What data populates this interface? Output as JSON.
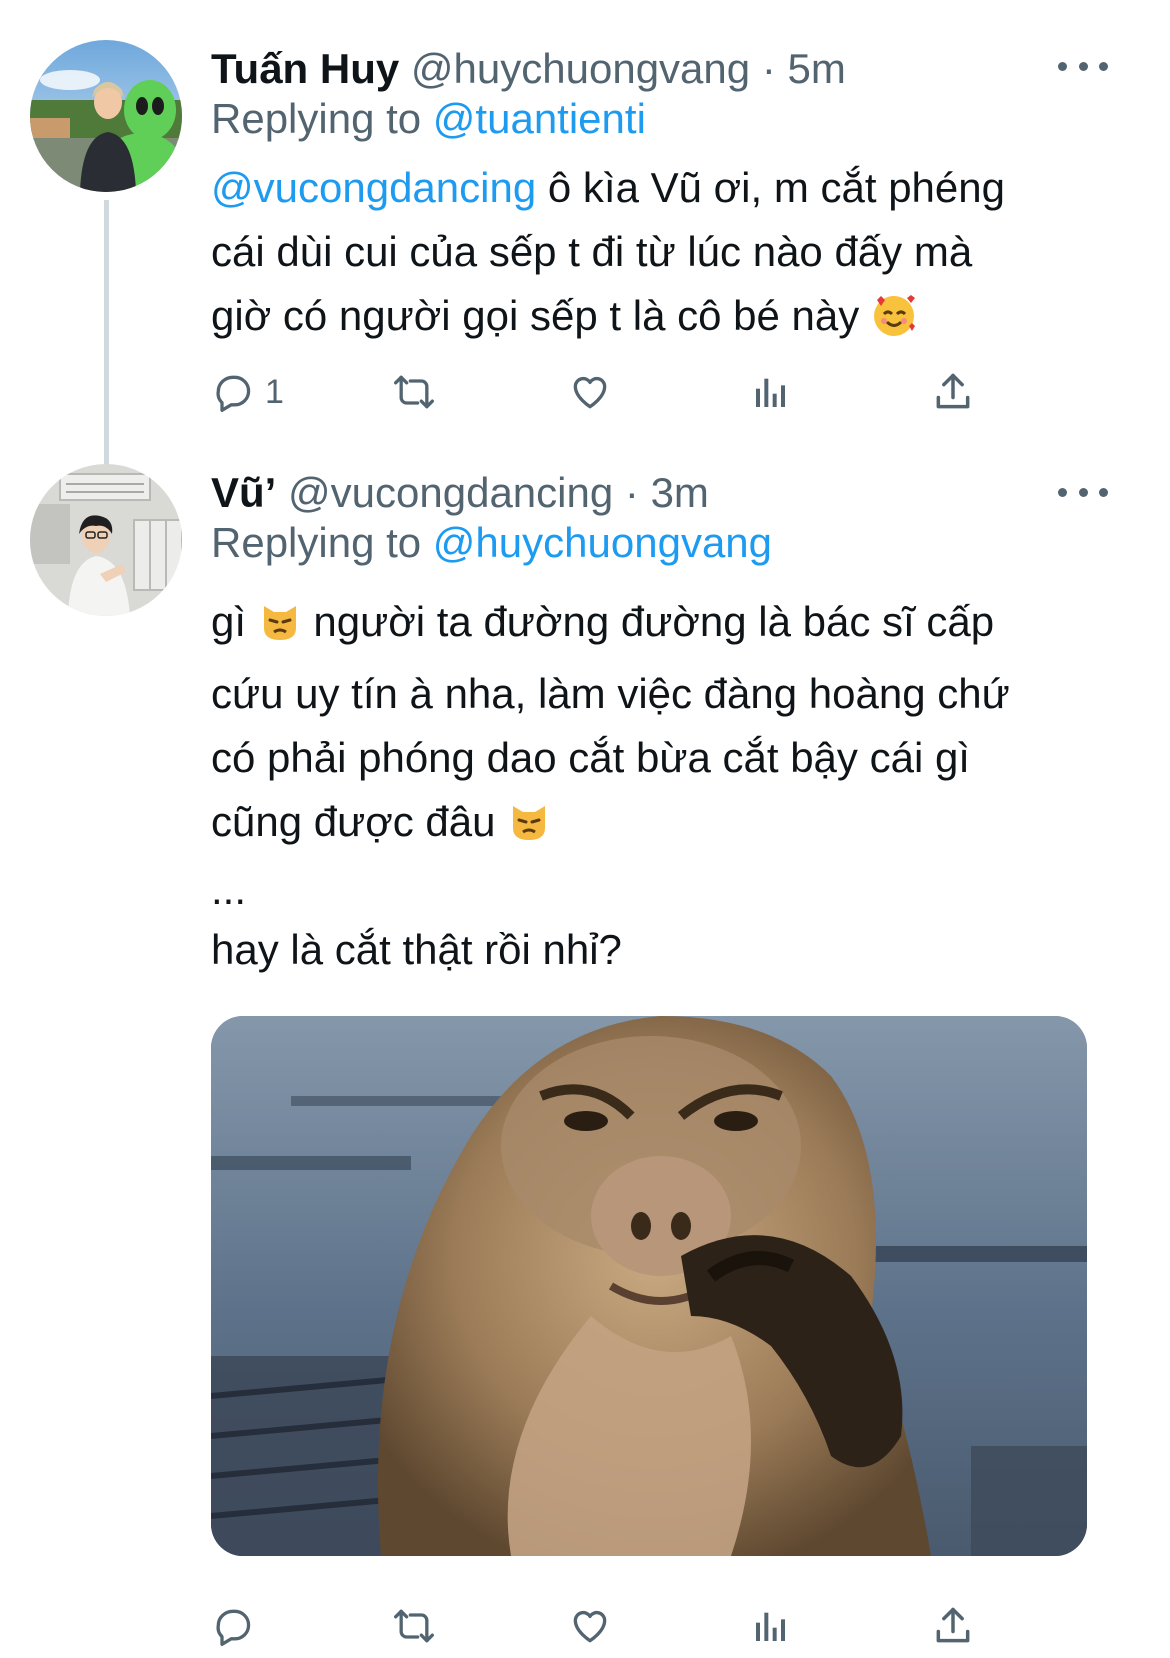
{
  "tweets": [
    {
      "name": "Tuấn Huy",
      "handle": "@huychuongvang",
      "separator": "·",
      "time": "5m",
      "replying_prefix": "Replying to",
      "replying_to": "@tuantienti",
      "body_mention": "@vucongdancing",
      "body_line1": " ô kìa Vũ ơi, m cắt phéng",
      "body_line2": "cái dùi cui của sếp t đi từ lúc nào đấy mà",
      "body_line3": "giờ có người gọi sếp t là cô bé này ",
      "body_emoji": "smiling-face-with-hearts",
      "reply_count": "1"
    },
    {
      "name": "Vũ’",
      "handle": "@vucongdancing",
      "separator": "·",
      "time": "3m",
      "replying_prefix": "Replying to",
      "replying_to": "@huychuongvang",
      "body_line1a": "gì ",
      "body_line1b": "  người ta đường đường là bác sĩ cấp",
      "body_line2": "cứu uy tín à nha, làm việc đàng hoàng chứ",
      "body_line3": "có phải phóng dao cắt bừa cắt bậy cái gì",
      "body_line4": "cũng được đâu ",
      "body_line5": "...",
      "body_line6": "hay là cắt thật rồi nhỉ?",
      "body_emoji": "pouting-cat-face",
      "media": "monkey-meme-image"
    }
  ],
  "colors": {
    "link": "#1d9bf0",
    "secondary_text": "#536471",
    "thread_line": "#cfd9de"
  },
  "icons": [
    "reply-icon",
    "retweet-icon",
    "like-icon",
    "analytics-icon",
    "share-icon",
    "more-icon"
  ]
}
